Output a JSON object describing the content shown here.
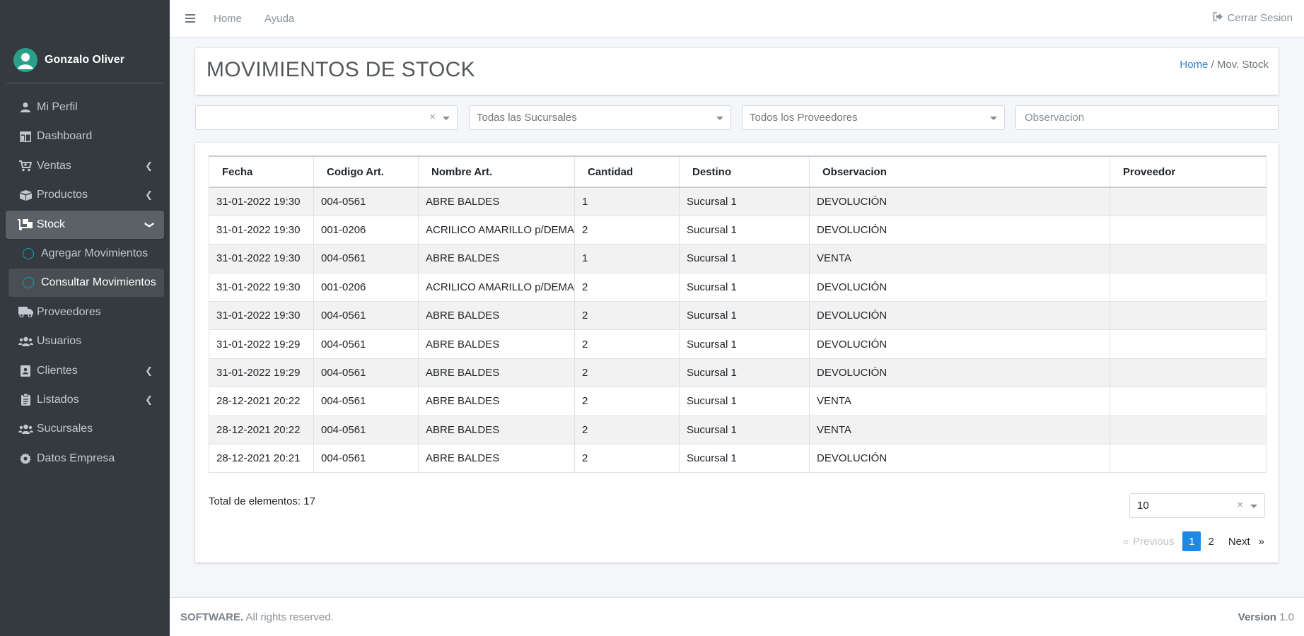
{
  "sidebar": {
    "user_name": "Gonzalo Oliver",
    "items": [
      {
        "label": "Mi Perfil",
        "icon": "user-icon",
        "chevron": false,
        "active": false
      },
      {
        "label": "Dashboard",
        "icon": "columns-icon",
        "chevron": false,
        "active": false
      },
      {
        "label": "Ventas",
        "icon": "cart-icon",
        "chevron": true,
        "active": false
      },
      {
        "label": "Productos",
        "icon": "boxes-icon",
        "chevron": true,
        "active": false
      },
      {
        "label": "Stock",
        "icon": "dolly-icon",
        "chevron": true,
        "active": true
      },
      {
        "label": "Agregar Movimientos",
        "icon": "circle-icon",
        "sub": true,
        "active": false
      },
      {
        "label": "Consultar Movimientos",
        "icon": "circle-icon",
        "sub": true,
        "active": true
      },
      {
        "label": "Proveedores",
        "icon": "truck-icon",
        "chevron": false,
        "active": false
      },
      {
        "label": "Usuarios",
        "icon": "users-icon",
        "chevron": false,
        "active": false
      },
      {
        "label": "Clientes",
        "icon": "contact-icon",
        "chevron": true,
        "active": false
      },
      {
        "label": "Listados",
        "icon": "clipboard-icon",
        "chevron": true,
        "active": false
      },
      {
        "label": "Sucursales",
        "icon": "users-icon",
        "chevron": false,
        "active": false
      },
      {
        "label": "Datos Empresa",
        "icon": "gear-icon",
        "chevron": false,
        "active": false
      }
    ]
  },
  "topbar": {
    "links": [
      "Home",
      "Ayuda"
    ],
    "logout": "Cerrar Sesion"
  },
  "header": {
    "title": "MOVIMIENTOS DE STOCK",
    "breadcrumb_home": "Home",
    "breadcrumb_sep": "/",
    "breadcrumb_current": "Mov. Stock"
  },
  "filters": {
    "date_value": "",
    "branch_placeholder": "Todas las Sucursales",
    "supplier_placeholder": "Todos los Proveedores",
    "observation_placeholder": "Observacion"
  },
  "table": {
    "columns": [
      "Fecha",
      "Codigo Art.",
      "Nombre Art.",
      "Cantidad",
      "Destino",
      "Observacion",
      "Proveedor"
    ],
    "rows": [
      [
        "31-01-2022 19:30",
        "004-0561",
        "ABRE BALDES",
        "1",
        "Sucursal 1",
        "DEVOLUCIÓN",
        ""
      ],
      [
        "31-01-2022 19:30",
        "001-0206",
        "ACRILICO AMARILLO p/DEMAR",
        "2",
        "Sucursal 1",
        "DEVOLUCIÓN",
        ""
      ],
      [
        "31-01-2022 19:30",
        "004-0561",
        "ABRE BALDES",
        "1",
        "Sucursal 1",
        "VENTA",
        ""
      ],
      [
        "31-01-2022 19:30",
        "001-0206",
        "ACRILICO AMARILLO p/DEMAR",
        "2",
        "Sucursal 1",
        "DEVOLUCIÓN",
        ""
      ],
      [
        "31-01-2022 19:30",
        "004-0561",
        "ABRE BALDES",
        "2",
        "Sucursal 1",
        "DEVOLUCIÓN",
        ""
      ],
      [
        "31-01-2022 19:29",
        "004-0561",
        "ABRE BALDES",
        "2",
        "Sucursal 1",
        "DEVOLUCIÓN",
        ""
      ],
      [
        "31-01-2022 19:29",
        "004-0561",
        "ABRE BALDES",
        "2",
        "Sucursal 1",
        "DEVOLUCIÓN",
        ""
      ],
      [
        "28-12-2021 20:22",
        "004-0561",
        "ABRE BALDES",
        "2",
        "Sucursal 1",
        "VENTA",
        ""
      ],
      [
        "28-12-2021 20:22",
        "004-0561",
        "ABRE BALDES",
        "2",
        "Sucursal 1",
        "VENTA",
        ""
      ],
      [
        "28-12-2021 20:21",
        "004-0561",
        "ABRE BALDES",
        "2",
        "Sucursal 1",
        "DEVOLUCIÓN",
        ""
      ]
    ],
    "total_label": "Total de elementos: 17",
    "page_size": "10"
  },
  "pagination": {
    "first": "«",
    "previous": "Previous",
    "pages": [
      "1",
      "2"
    ],
    "current": "1",
    "next": "Next",
    "last": "»"
  },
  "footer": {
    "brand": "SOFTWARE.",
    "rights": " All rights reserved.",
    "version_label": "Version",
    "version_value": " 1.0"
  },
  "colors": {
    "sidebar_bg": "#343a40",
    "accent": "#1e88e5",
    "avatar": "#28a08a",
    "link": "#2f7fc4"
  }
}
